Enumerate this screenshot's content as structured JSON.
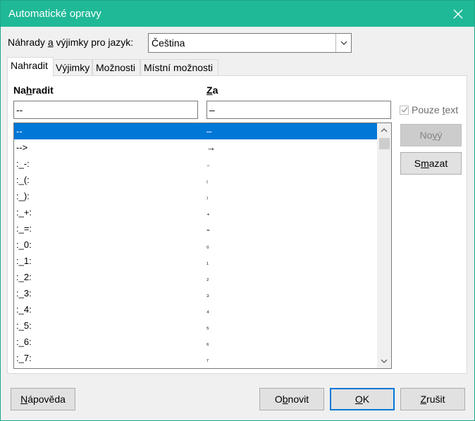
{
  "window": {
    "title": "Automatické opravy"
  },
  "language": {
    "label_pre": "Náhrady ",
    "label_ul": "a",
    "label_post": " výjimky pro jazyk:",
    "value": "Čeština"
  },
  "tabs": [
    {
      "label": "Nahradit"
    },
    {
      "label": "Výjimky"
    },
    {
      "label": "Možnosti"
    },
    {
      "label": "Místní možnosti"
    }
  ],
  "replace": {
    "header_pre": "Na",
    "header_ul": "h",
    "header_post": "radit",
    "with_ul": "Z",
    "with_post": "a",
    "replace_value": "--",
    "with_value": "–",
    "text_only_pre": "Pouze ",
    "text_only_ul": "t",
    "text_only_post": "ext",
    "new_pre": "No",
    "new_ul": "v",
    "new_post": "ý",
    "delete_pre": "S",
    "delete_ul": "m",
    "delete_post": "azat"
  },
  "rows": [
    {
      "from": "--",
      "to": "–"
    },
    {
      "from": "-->",
      "to": "→"
    },
    {
      "from": ":_-:",
      "to": "₋"
    },
    {
      "from": ":_(:",
      "to": "₍"
    },
    {
      "from": ":_):",
      "to": "₎"
    },
    {
      "from": ":_+:",
      "to": "₊"
    },
    {
      "from": ":_=:",
      "to": "₌"
    },
    {
      "from": ":_0:",
      "to": "₀"
    },
    {
      "from": ":_1:",
      "to": "₁"
    },
    {
      "from": ":_2:",
      "to": "₂"
    },
    {
      "from": ":_3:",
      "to": "₃"
    },
    {
      "from": ":_4:",
      "to": "₄"
    },
    {
      "from": ":_5:",
      "to": "₅"
    },
    {
      "from": ":_6:",
      "to": "₆"
    },
    {
      "from": ":_7:",
      "to": "₇"
    }
  ],
  "footer": {
    "help_pre": "",
    "help_ul": "N",
    "help_post": "ápověda",
    "reset_pre": "O",
    "reset_ul": "b",
    "reset_post": "novit",
    "ok_ul": "O",
    "ok_post": "K",
    "cancel_ul": "Z",
    "cancel_post": "rušit"
  },
  "colors": {
    "titlebar": "#1fb997",
    "selection": "#0078d7"
  }
}
